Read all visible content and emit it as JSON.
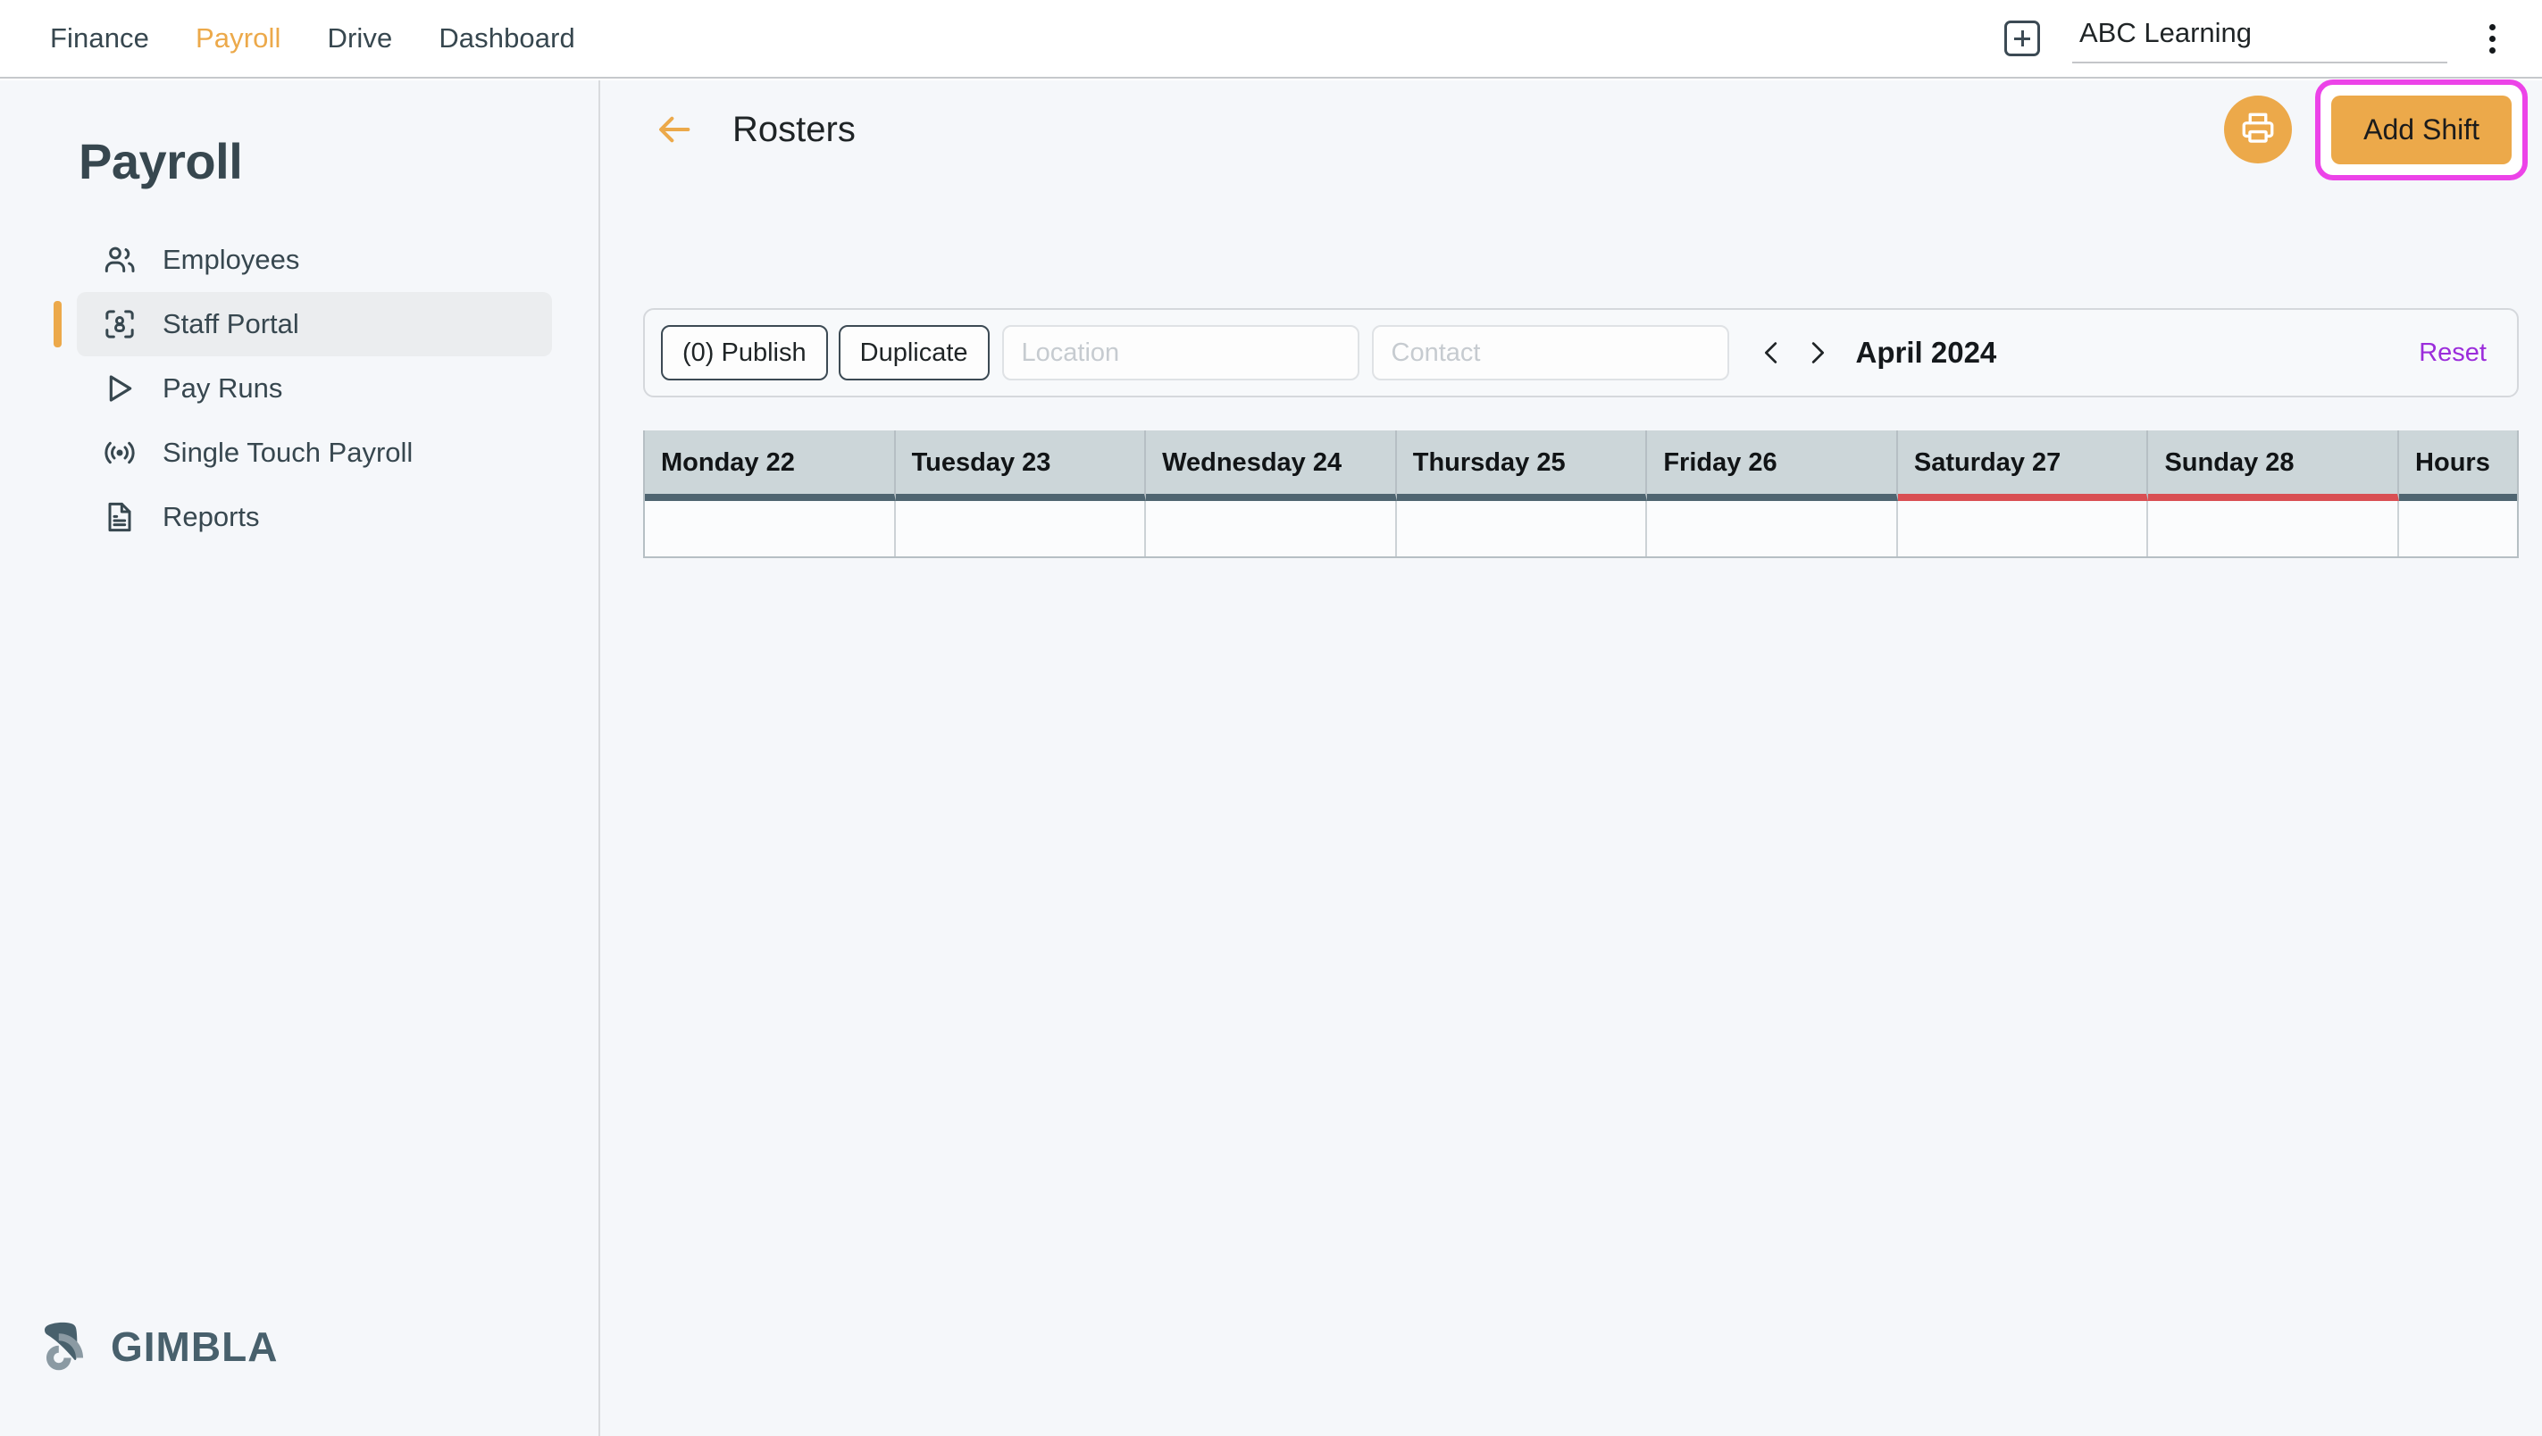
{
  "topnav": {
    "links": [
      {
        "label": "Finance",
        "active": false
      },
      {
        "label": "Payroll",
        "active": true
      },
      {
        "label": "Drive",
        "active": false
      },
      {
        "label": "Dashboard",
        "active": false
      }
    ],
    "add_icon": "plus-square-icon",
    "org_value": "ABC Learning",
    "org_placeholder": "Organisation",
    "menu_icon": "kebab-menu-icon"
  },
  "sidebar": {
    "title": "Payroll",
    "items": [
      {
        "label": "Employees",
        "icon": "users-icon",
        "active": false
      },
      {
        "label": "Staff Portal",
        "icon": "scan-person-icon",
        "active": true
      },
      {
        "label": "Pay Runs",
        "icon": "play-triangle-icon",
        "active": false
      },
      {
        "label": "Single Touch Payroll",
        "icon": "broadcast-icon",
        "active": false
      },
      {
        "label": "Reports",
        "icon": "document-lines-icon",
        "active": false
      }
    ],
    "logo": {
      "text": "GIMBLA",
      "icon": "gimbla-signal-logo"
    }
  },
  "main": {
    "back_icon": "arrow-left-icon",
    "title": "Rosters",
    "print_icon": "printer-icon",
    "add_shift_label": "Add Shift",
    "highlight_color": "#ec43e8"
  },
  "toolbar": {
    "publish_label": "(0) Publish",
    "duplicate_label": "Duplicate",
    "location_value": "",
    "location_placeholder": "Location",
    "contact_value": "",
    "contact_placeholder": "Contact",
    "prev_icon": "chevron-left-icon",
    "next_icon": "chevron-right-icon",
    "period_label": "April 2024",
    "reset_label": "Reset",
    "reset_color": "#9b2cdb"
  },
  "roster": {
    "columns": [
      {
        "label": "Monday 22",
        "weekend": false
      },
      {
        "label": "Tuesday 23",
        "weekend": false
      },
      {
        "label": "Wednesday 24",
        "weekend": false
      },
      {
        "label": "Thursday 25",
        "weekend": false
      },
      {
        "label": "Friday 26",
        "weekend": false
      },
      {
        "label": "Saturday 27",
        "weekend": true
      },
      {
        "label": "Sunday 28",
        "weekend": true
      },
      {
        "label": "Hours",
        "weekend": false
      }
    ],
    "rows": [
      {
        "cells": [
          "",
          "",
          "",
          "",
          "",
          "",
          "",
          ""
        ]
      }
    ],
    "header_bg": "#ccd6d9",
    "underline_color": "#4f6571",
    "weekend_underline_color": "#d94f53"
  },
  "theme": {
    "accent": "#eca94a",
    "slate": "#37474f",
    "page_bg": "#f5f7fa"
  }
}
